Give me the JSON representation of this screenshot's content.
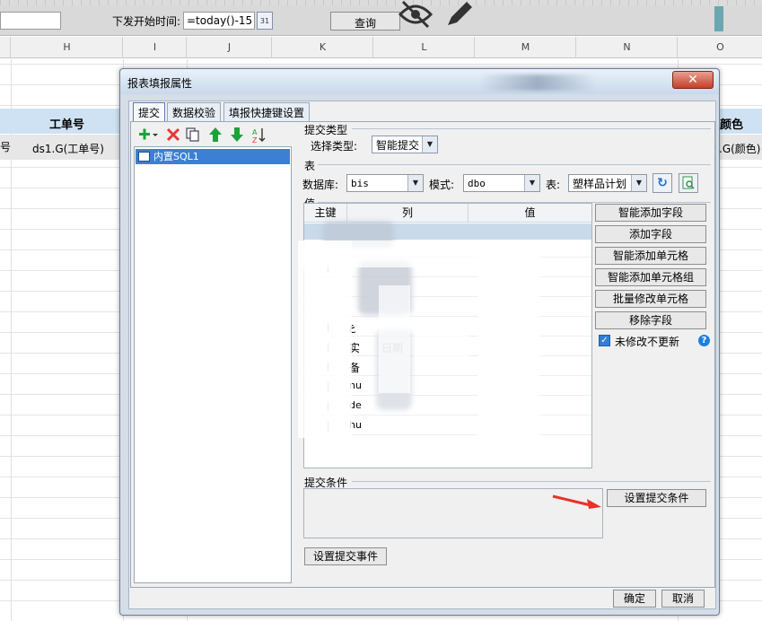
{
  "toolbar": {
    "start_time_label": "下发开始时间:",
    "start_time_value": "=today()-15",
    "calendar_label": "31",
    "query_label": "查询"
  },
  "columns": [
    "H",
    "I",
    "J",
    "K",
    "L",
    "M",
    "N",
    "O"
  ],
  "sheet": {
    "header_gongdanhao": "工单号",
    "header_color": "颜色",
    "row_hao": "号",
    "cell_ds1_gongdanhao": "ds1.G(工单号)",
    "cell_ds1_color": ".G(颜色)"
  },
  "dialog": {
    "title": "报表填报属性",
    "close_label": "✕",
    "tabs": [
      "提交",
      "数据校验",
      "填报快捷键设置"
    ],
    "left_list": {
      "items": [
        "内置SQL1"
      ]
    },
    "submit_type": {
      "group_label": "提交类型",
      "label": "选择类型:",
      "value": "智能提交"
    },
    "table_group": {
      "group_label": "表",
      "db_label": "数据库:",
      "db_value": "bis",
      "schema_label": "模式:",
      "schema_value": "dbo",
      "table_label": "表:",
      "table_value": "塑样品计划"
    },
    "values_group": {
      "group_label": "值",
      "columns": [
        "主键",
        "列",
        "值"
      ],
      "visible_rows": [
        "ع",
        "实",
        "日期",
        "备",
        "nu",
        "de",
        "hu"
      ]
    },
    "side_buttons": [
      "智能添加字段",
      "添加字段",
      "智能添加单元格",
      "智能添加单元格组",
      "批量修改单元格",
      "移除字段"
    ],
    "checkbox": {
      "label": "未修改不更新",
      "checked": true
    },
    "condition": {
      "group_label": "提交条件",
      "button_label": "设置提交条件"
    },
    "event_button": "设置提交事件",
    "ok_label": "确定",
    "cancel_label": "取消"
  },
  "colors": {
    "header_row": "#cfe2f3",
    "selection": "#3c7fd4",
    "arrow": "#e8312a",
    "add_icon": "#1aa33a",
    "delete_icon": "#e53935"
  }
}
